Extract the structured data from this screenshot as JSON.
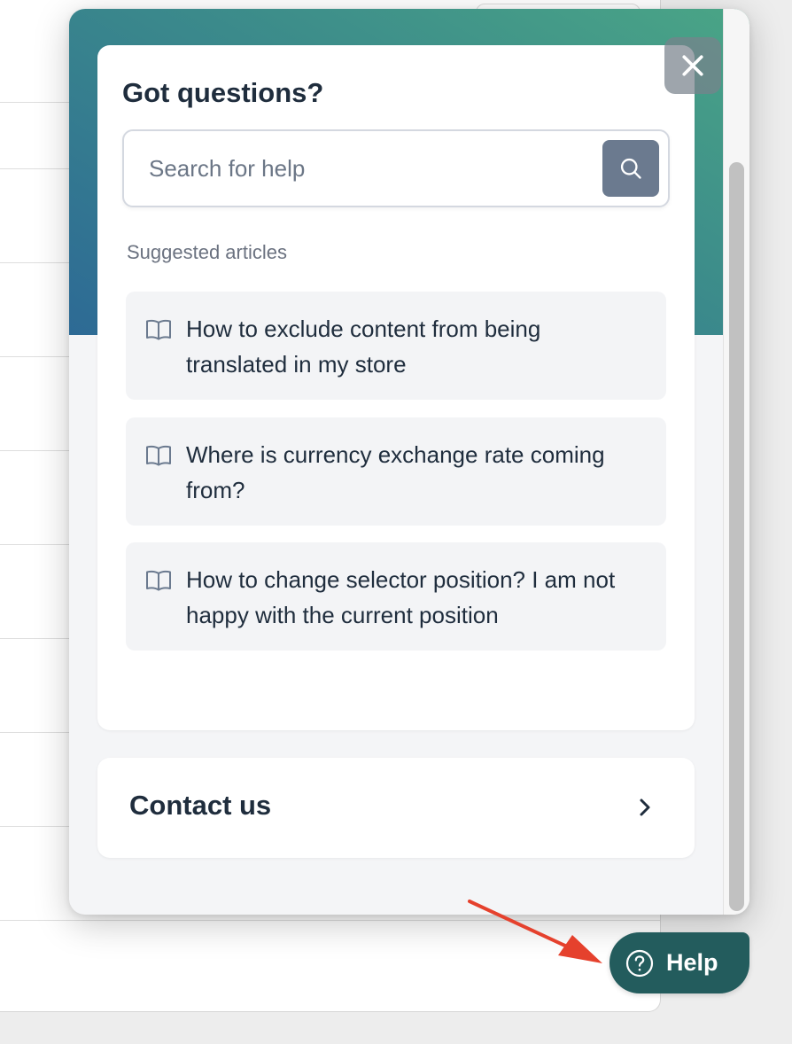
{
  "widget": {
    "title": "Got questions?",
    "search": {
      "placeholder": "Search for help",
      "value": ""
    },
    "suggested_label": "Suggested articles",
    "articles": [
      {
        "title": "How to exclude content from being translated in my store",
        "icon": "book-icon"
      },
      {
        "title": "Where is currency exchange rate coming from?",
        "icon": "book-icon"
      },
      {
        "title": "How to change selector position? I am not happy with the current position",
        "icon": "book-icon"
      }
    ],
    "contact_label": "Contact us",
    "close_icon": "close-icon",
    "search_icon": "search-icon",
    "contact_icon": "chevron-right-icon"
  },
  "launcher": {
    "label": "Help",
    "icon": "question-circle-icon"
  },
  "annotation": {
    "icon": "red-arrow-pointer"
  },
  "colors": {
    "hero_gradient_start": "#4aa586",
    "hero_gradient_end": "#2d6a95",
    "launcher_bg": "#235c5d",
    "search_button_bg": "#6b7a8f",
    "annotation_arrow": "#e5412d",
    "text_primary": "#1f2d3d"
  }
}
